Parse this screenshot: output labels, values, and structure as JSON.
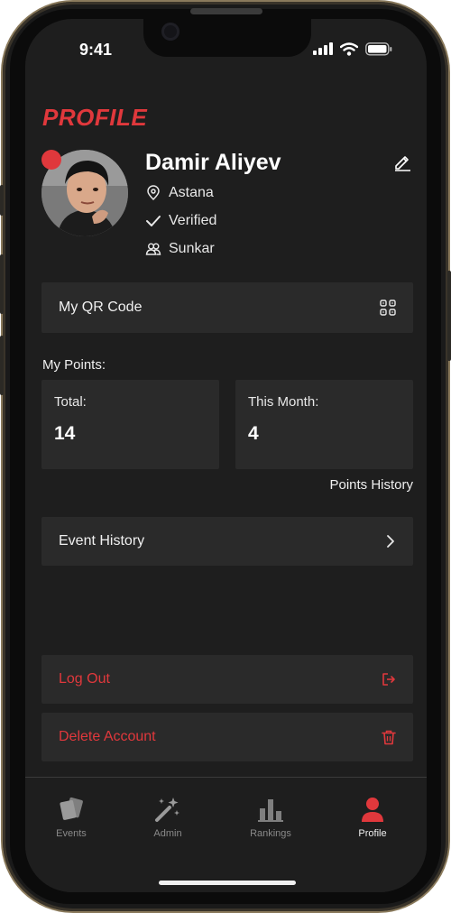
{
  "status_bar": {
    "time": "9:41"
  },
  "page": {
    "title": "PROFILE"
  },
  "profile": {
    "name": "Damir Aliyev",
    "location": "Astana",
    "verification": "Verified",
    "team": "Sunkar"
  },
  "qr": {
    "label": "My QR Code"
  },
  "points": {
    "section_label": "My Points:",
    "total_label": "Total:",
    "total_value": "14",
    "month_label": "This Month:",
    "month_value": "4",
    "history_link": "Points History"
  },
  "event_history": {
    "label": "Event History"
  },
  "actions": {
    "logout": "Log Out",
    "delete": "Delete Account"
  },
  "tabs": [
    {
      "label": "Events",
      "icon": "cards-icon"
    },
    {
      "label": "Admin",
      "icon": "magic-wand-icon"
    },
    {
      "label": "Rankings",
      "icon": "bar-chart-icon"
    },
    {
      "label": "Profile",
      "icon": "user-icon",
      "active": true
    }
  ],
  "colors": {
    "accent": "#e0383c",
    "background": "#1e1e1e",
    "card": "#2a2a2a"
  }
}
